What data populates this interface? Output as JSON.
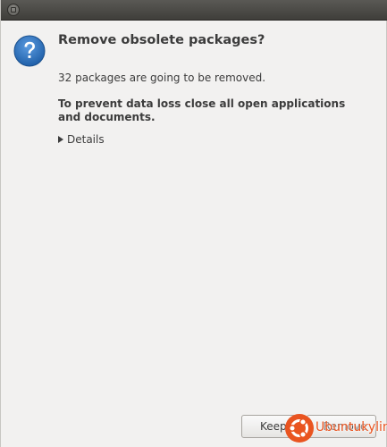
{
  "dialog": {
    "title": "Remove obsolete packages?",
    "message": "32 packages are going to be removed.",
    "warning": "To prevent data loss close all open applications and documents.",
    "details_label": "Details",
    "icon": "question-icon"
  },
  "buttons": {
    "keep_label": "Keep",
    "remove_label": "Remove"
  },
  "watermark": {
    "text": "Ubuntukylin",
    "color": "#e95420"
  },
  "colors": {
    "icon_blue": "#2a6fb8",
    "background": "#f2f1f0",
    "titlebar": "#3f3e3a"
  }
}
